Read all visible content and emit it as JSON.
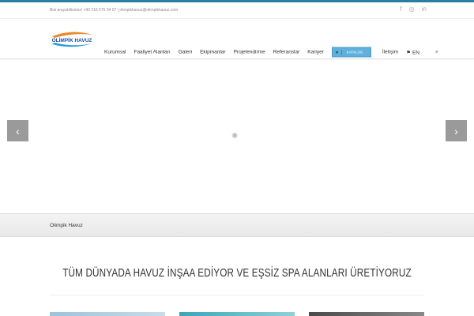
{
  "topbar": {
    "contact": "Bizi arayabilirsiniz! +90 216 576 04 07  |  olimpikhavuz@olimpikhavuz.com",
    "social": [
      "f",
      "◎",
      "in"
    ]
  },
  "logo": {
    "text": "OLİMPİK HAVUZ"
  },
  "nav": {
    "items": [
      "Kurumsal",
      "Faaliyet Alanları",
      "Galeri",
      "Ekipmanlar",
      "Projelendirme",
      "Referanslar",
      "Kariyer"
    ],
    "katalog": "KATALOG",
    "iletisim": "İletişim",
    "lang": "EN"
  },
  "slider": {
    "prev": "‹",
    "next": "›"
  },
  "breadcrumb": {
    "title": "Olimpik Havuz"
  },
  "main": {
    "heading": "TÜM DÜNYADA HAVUZ İNŞAA EDİYOR VE EŞSİZ SPA ALANLARI ÜRETİYORUZ"
  }
}
